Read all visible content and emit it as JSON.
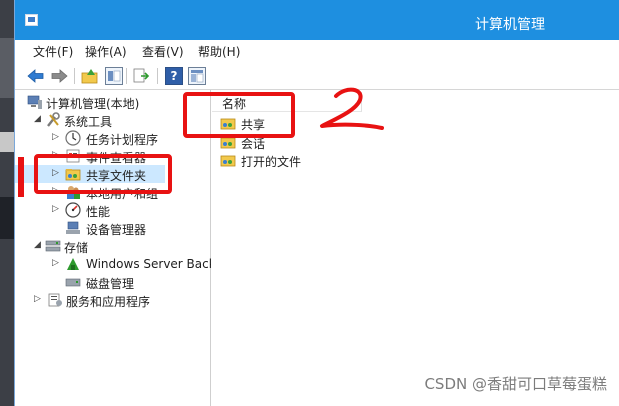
{
  "window": {
    "title": "计算机管理"
  },
  "menu": [
    "文件(F)",
    "操作(A)",
    "查看(V)",
    "帮助(H)"
  ],
  "toolbar": {
    "help_glyph": "?",
    "icons": [
      "back-arrow-icon",
      "forward-arrow-icon",
      "up-folder-icon",
      "show-hide-tree-icon",
      "export-list-icon",
      "help-icon",
      "view-icon"
    ]
  },
  "tree": {
    "root": "计算机管理(本地)",
    "system_tools": "系统工具",
    "task_scheduler": "任务计划程序",
    "event_viewer": "事件查看器",
    "shared_folders": "共享文件夹",
    "local_users": "本地用户和组",
    "performance": "性能",
    "device_manager": "设备管理器",
    "storage": "存储",
    "windows_server_backup": "Windows Server Back",
    "disk_management": "磁盘管理",
    "services": "服务和应用程序"
  },
  "list": {
    "column_name": "名称",
    "items": [
      "共享",
      "会话",
      "打开的文件"
    ]
  },
  "annotation": {
    "handwritten_number": "2",
    "mark_color": "#e81212"
  },
  "watermark": "CSDN @香甜可口草莓蛋糕",
  "colors": {
    "titlebar": "#1e8fe0",
    "selection": "#cce8ff"
  }
}
